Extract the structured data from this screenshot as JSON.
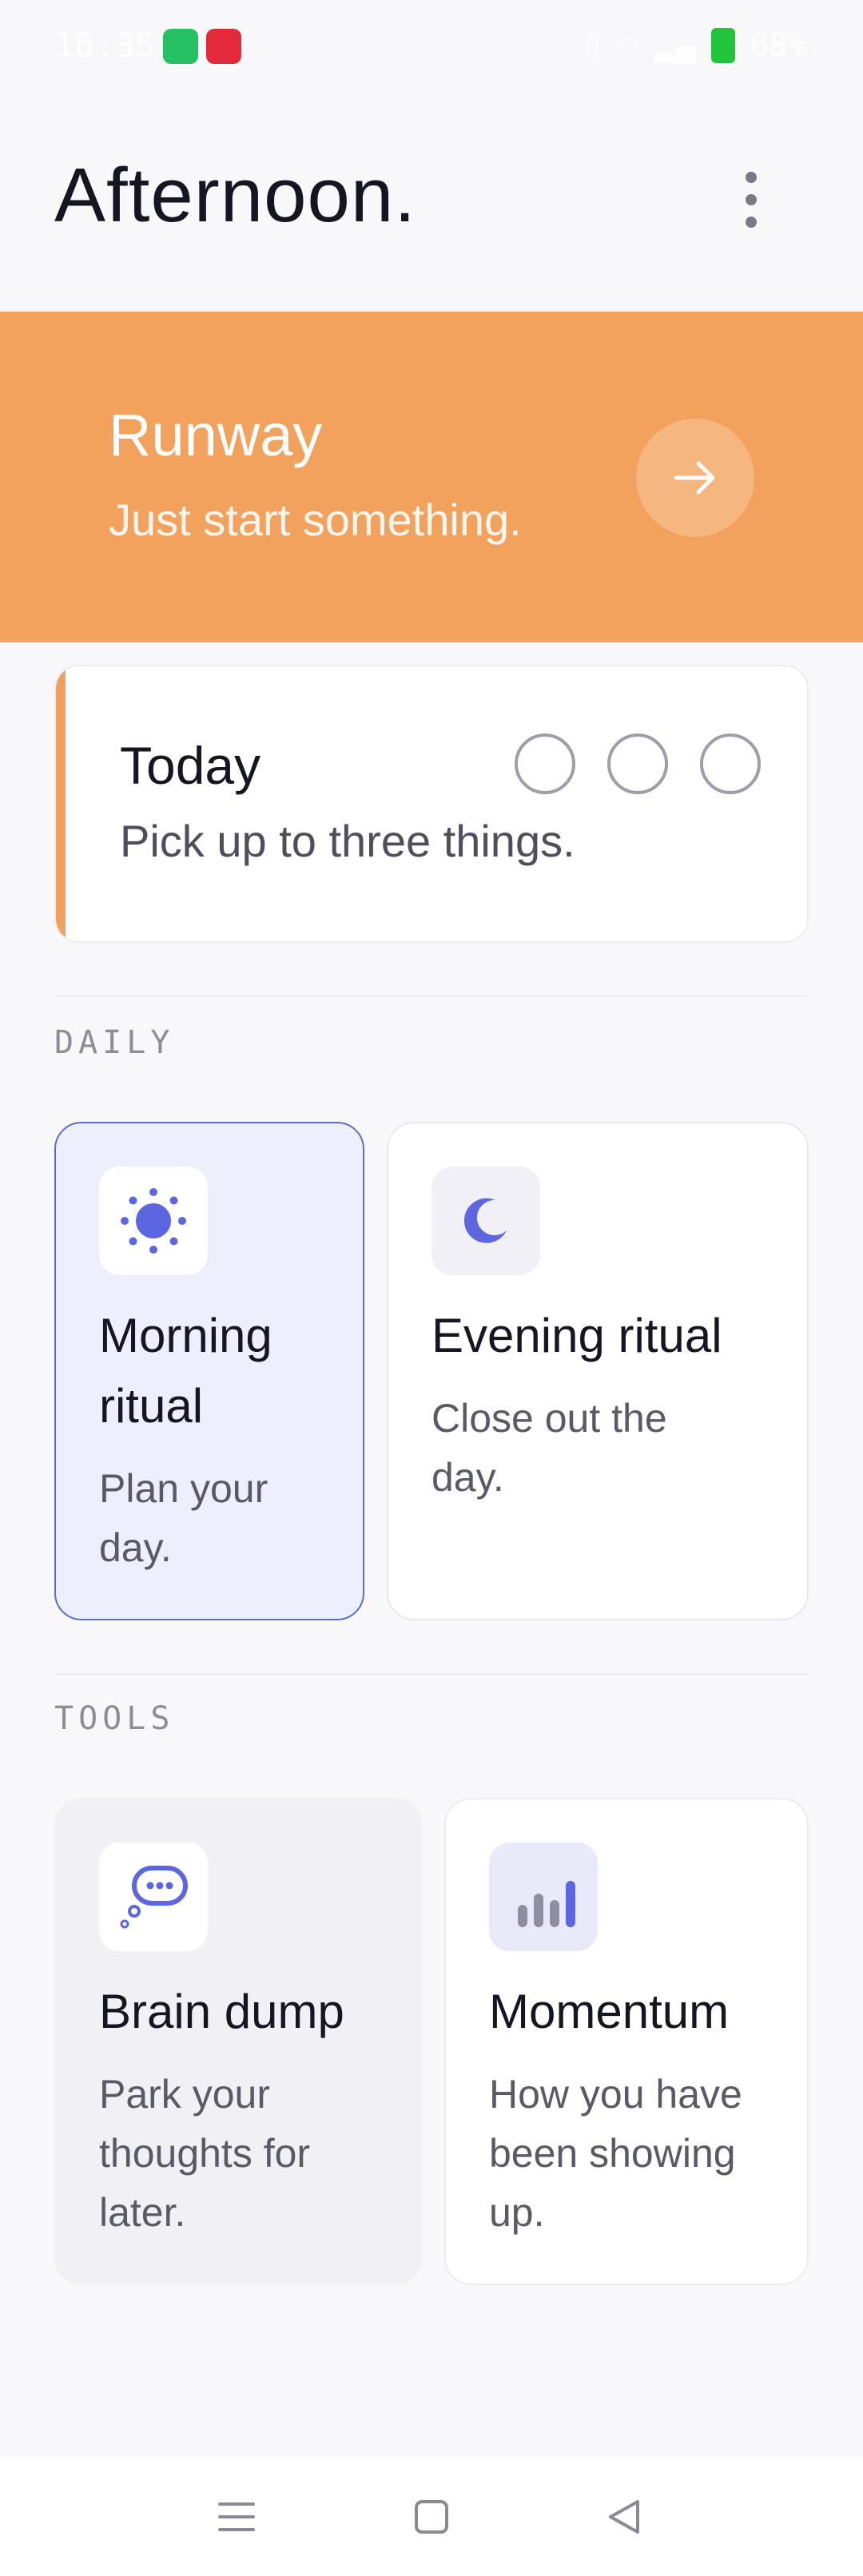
{
  "status_bar": {
    "time": "16:35",
    "battery": "68%",
    "icons": [
      "whatsapp-icon",
      "tesla-icon",
      "vibrate-icon",
      "signal-icon",
      "wifi-icon",
      "battery-icon"
    ]
  },
  "header": {
    "title": "Afternoon.",
    "menu_icon": "more-vertical-icon"
  },
  "banner": {
    "title": "Runway",
    "subtitle": "Just start something.",
    "action_icon": "arrow-right-icon",
    "color": "#f2a25c"
  },
  "today": {
    "title": "Today",
    "subtitle": "Pick up to three things.",
    "slots": [
      false,
      false,
      false
    ]
  },
  "sections": {
    "daily": "DAILY",
    "tools": "TOOLS"
  },
  "daily_cards": [
    {
      "title_line1": "Morning",
      "title_line2": "ritual",
      "desc_line1": "Plan your",
      "desc_line2": "day.",
      "icon": "sun-icon",
      "selected": true
    },
    {
      "title_line1": "Evening ritual",
      "desc_line1": "Close out the",
      "desc_line2": "day.",
      "icon": "moon-icon",
      "selected": false
    }
  ],
  "tool_cards": [
    {
      "title_line1": "Brain dump",
      "desc_line1": "Park your",
      "desc_line2": "thoughts for",
      "desc_line3": "later.",
      "icon": "thought-bubble-icon"
    },
    {
      "title_line1": "Momentum",
      "desc_line1": "How you have",
      "desc_line2": "been showing",
      "desc_line3": "up.",
      "icon": "bar-chart-icon"
    }
  ],
  "accent_colors": {
    "primary": "#5b66e0",
    "orange": "#f2a25c"
  }
}
